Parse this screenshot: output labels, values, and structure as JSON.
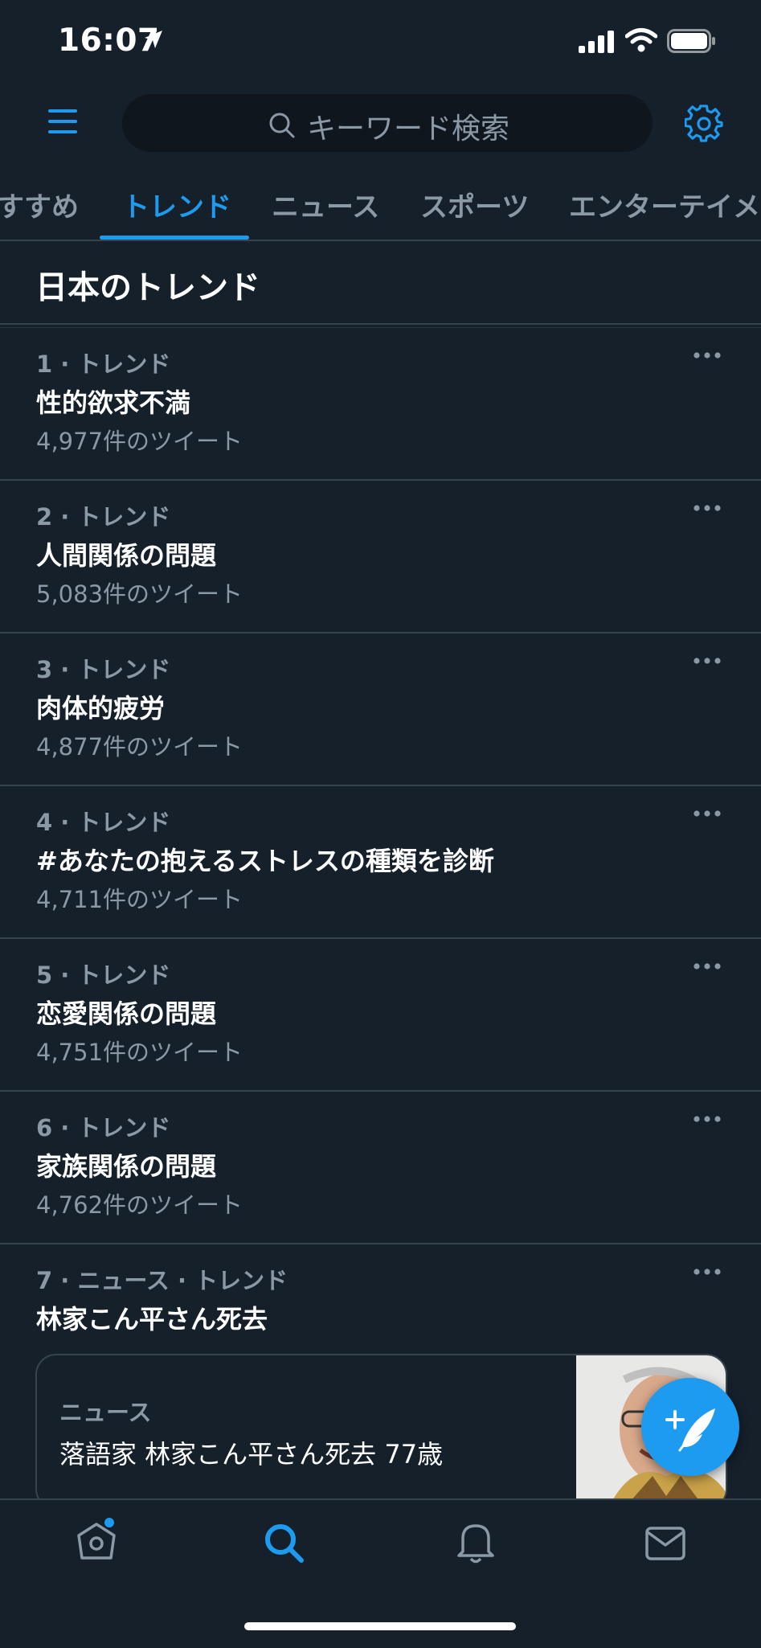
{
  "status_bar": {
    "time": "16:07"
  },
  "header": {
    "search_placeholder": "キーワード検索"
  },
  "tabs": [
    {
      "label": "すすめ",
      "active": false
    },
    {
      "label": "トレンド",
      "active": true
    },
    {
      "label": "ニュース",
      "active": false
    },
    {
      "label": "スポーツ",
      "active": false
    },
    {
      "label": "エンターテイメント",
      "active": false
    }
  ],
  "section_title": "日本のトレンド",
  "trends": [
    {
      "meta": "1 · トレンド",
      "name": "性的欲求不満",
      "count": "4,977件のツイート"
    },
    {
      "meta": "2 · トレンド",
      "name": "人間関係の問題",
      "count": "5,083件のツイート"
    },
    {
      "meta": "3 · トレンド",
      "name": "肉体的疲労",
      "count": "4,877件のツイート"
    },
    {
      "meta": "4 · トレンド",
      "name": "#あなたの抱えるストレスの種類を診断",
      "count": "4,711件のツイート"
    },
    {
      "meta": "5 · トレンド",
      "name": "恋愛関係の問題",
      "count": "4,751件のツイート"
    },
    {
      "meta": "6 · トレンド",
      "name": "家族関係の問題",
      "count": "4,762件のツイート"
    },
    {
      "meta": "7 · ニュース · トレンド",
      "name": "林家こん平さん死去",
      "count": ""
    }
  ],
  "news_card": {
    "label": "ニュース",
    "headline": "落語家 林家こん平さん死去 77歳"
  },
  "bottom_nav": [
    {
      "icon": "home-icon",
      "active": false,
      "has_dot": true
    },
    {
      "icon": "search-icon",
      "active": true
    },
    {
      "icon": "bell-icon",
      "active": false
    },
    {
      "icon": "mail-icon",
      "active": false
    }
  ],
  "colors": {
    "background": "#15202b",
    "accent": "#1d9bf0",
    "muted": "#8b98a5",
    "divider": "#38444d"
  }
}
